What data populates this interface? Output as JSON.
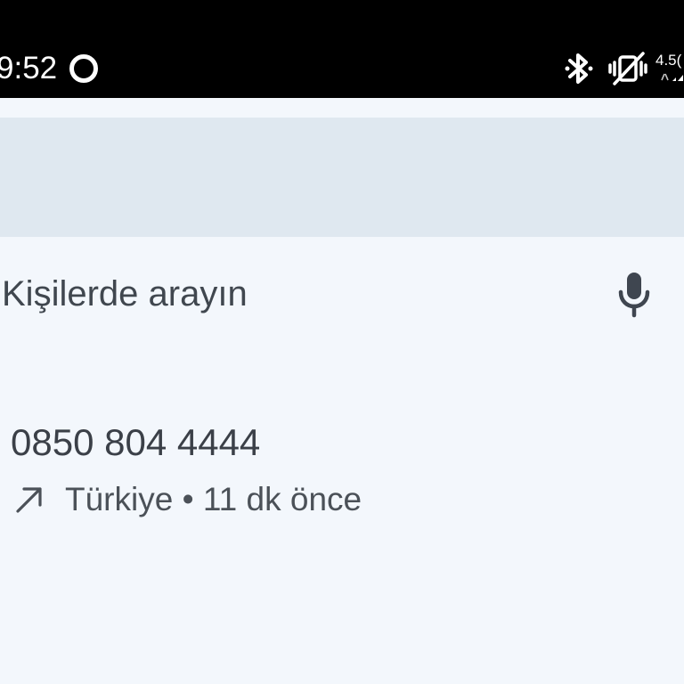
{
  "status_bar": {
    "time": "9:52",
    "network_speed": "4.5("
  },
  "search": {
    "placeholder": "Kişilerde arayın"
  },
  "recent_call": {
    "number": "0850 804 4444",
    "location": "Türkiye",
    "separator": "•",
    "time_ago": "11 dk önce",
    "direction": "outgoing"
  }
}
